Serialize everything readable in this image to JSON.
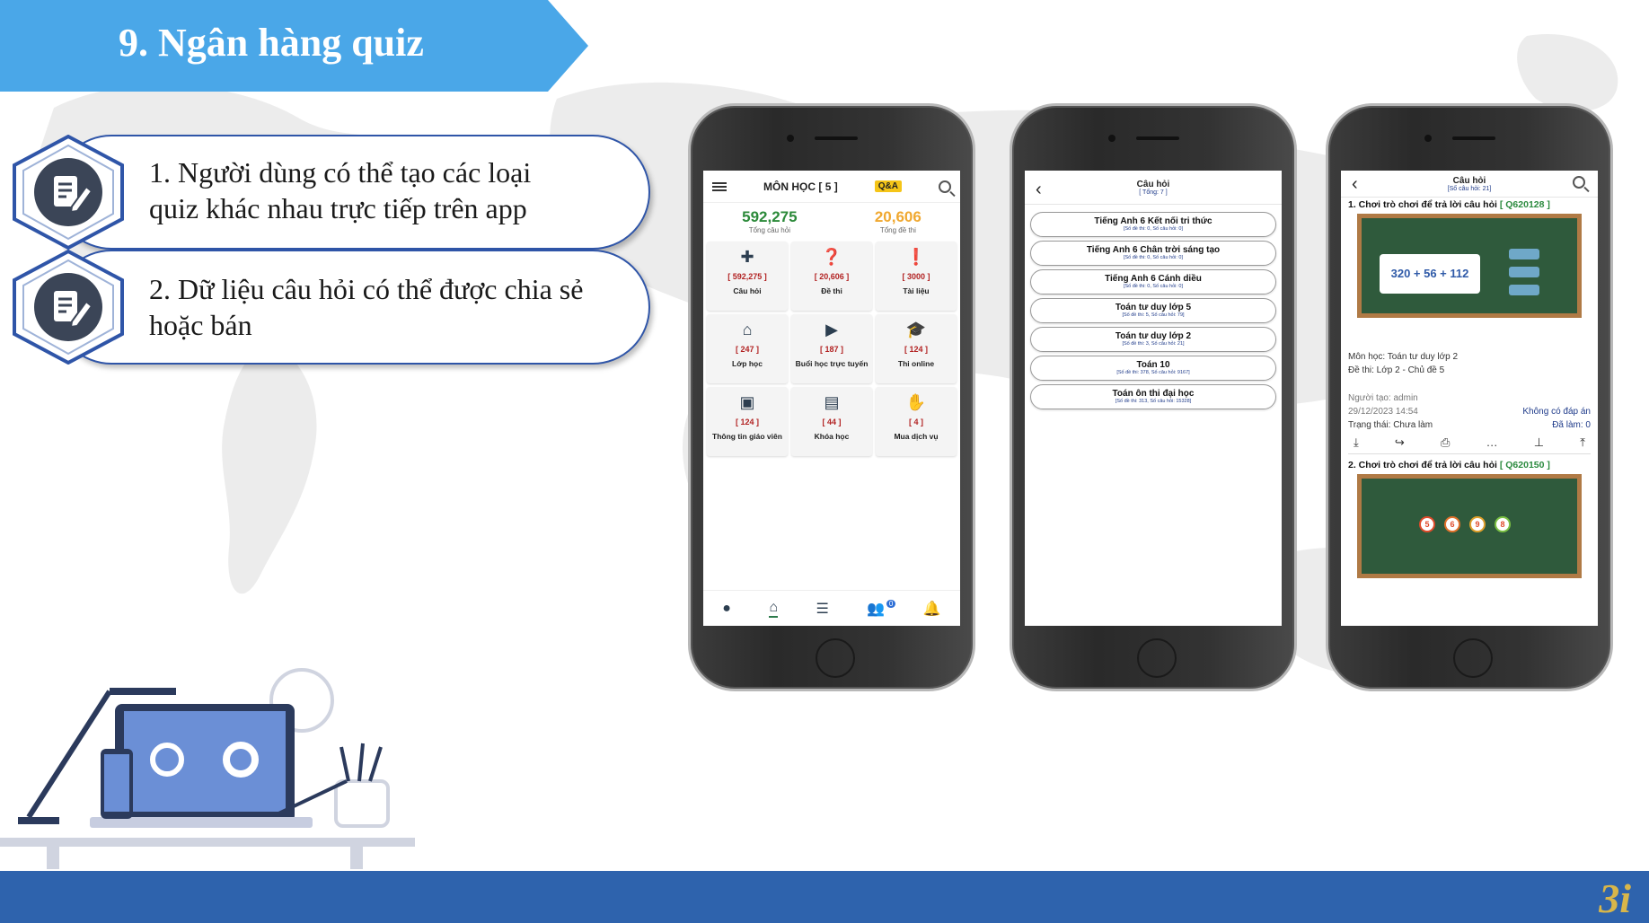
{
  "slide": {
    "title": "9. Ngân hàng quiz"
  },
  "features": [
    {
      "line1": "1. Người dùng có thể tạo các loại",
      "line2": "quiz khác nhau trực tiếp trên app"
    },
    {
      "line1": "2. Dữ liệu câu hỏi có thể được chia sẻ",
      "line2": "hoặc bán"
    }
  ],
  "phone1": {
    "title": "MÔN HỌC [ 5 ]",
    "qa_badge": "Q&A",
    "stats": [
      {
        "value": "592,275",
        "label": "Tổng câu hỏi",
        "color": "#2c8a3a"
      },
      {
        "value": "20,606",
        "label": "Tổng đề thi",
        "color": "#f0a830"
      }
    ],
    "tiles": [
      {
        "icon": "puzzle-icon",
        "glyph": "✚",
        "count": "[ 592,275 ]",
        "label": "Câu hỏi"
      },
      {
        "icon": "exam-file-icon",
        "glyph": "❓",
        "count": "[ 20,606 ]",
        "label": "Đề thi"
      },
      {
        "icon": "document-icon",
        "glyph": "❗",
        "count": "[ 3000 ]",
        "label": "Tài liệu"
      },
      {
        "icon": "classroom-icon",
        "glyph": "⌂",
        "count": "[ 247 ]",
        "label": "Lớp học"
      },
      {
        "icon": "video-icon",
        "glyph": "▶",
        "count": "[ 187 ]",
        "label": "Buổi học trực tuyến"
      },
      {
        "icon": "graduation-cap-icon",
        "glyph": "🎓",
        "count": "[ 124 ]",
        "label": "Thi online"
      },
      {
        "icon": "teacher-icon",
        "glyph": "▣",
        "count": "[ 124 ]",
        "label": "Thông tin giáo viên"
      },
      {
        "icon": "course-icon",
        "glyph": "▤",
        "count": "[ 44 ]",
        "label": "Khóa học"
      },
      {
        "icon": "service-hand-icon",
        "glyph": "✋",
        "count": "[ 4 ]",
        "label": "Mua dịch vụ"
      }
    ],
    "nav_badge": "0"
  },
  "phone2": {
    "title": "Câu hỏi",
    "subtitle": "[ Tổng: 7 ]",
    "items": [
      {
        "name": "Tiếng Anh 6 Kết nối tri thức",
        "meta": "[Số đề thi: 0, Số câu hỏi: 0]"
      },
      {
        "name": "Tiếng Anh 6 Chân trời sáng tạo",
        "meta": "[Số đề thi: 0, Số câu hỏi: 0]"
      },
      {
        "name": "Tiếng Anh 6 Cánh diều",
        "meta": "[Số đề thi: 0, Số câu hỏi: 0]"
      },
      {
        "name": "Toán tư duy lớp 5",
        "meta": "[Số đề thi: 5, Số câu hỏi: 79]"
      },
      {
        "name": "Toán tư duy lớp 2",
        "meta": "[Số đề thi: 3, Số câu hỏi: 21]"
      },
      {
        "name": "Toán 10",
        "meta": "[Số đề thi: 378, Số câu hỏi: 9167]"
      },
      {
        "name": "Toán ôn thi đại học",
        "meta": "[Số đề thi: 313, Số câu hỏi: 15328]"
      }
    ]
  },
  "phone3": {
    "title": "Câu hỏi",
    "subtitle": "[Số câu hỏi: 21]",
    "q1_title": "1. Chơi trò chơi để trả lời câu hỏi",
    "q1_code": "[ Q620128 ]",
    "q1_board_text": "320 + 56 + 112",
    "subject": "Môn học: Toán tư duy lớp 2",
    "exam": "Đề thi: Lớp 2 - Chủ đề 5",
    "creator": "Người tạo: admin",
    "datetime": "29/12/2023 14:54",
    "answer_status": "Không có đáp án",
    "state": "Trạng thái: Chưa làm",
    "done": "Đã làm: 0",
    "q2_title": "2. Chơi trò chơi để trả lời câu hỏi",
    "q2_code": "[ Q620150 ]",
    "q2_numbers": [
      "5",
      "6",
      "9",
      "8"
    ]
  },
  "colors": {
    "banner": "#4aa7e8",
    "accent": "#2e63ad"
  },
  "footer": {
    "logo_text": "3i"
  }
}
